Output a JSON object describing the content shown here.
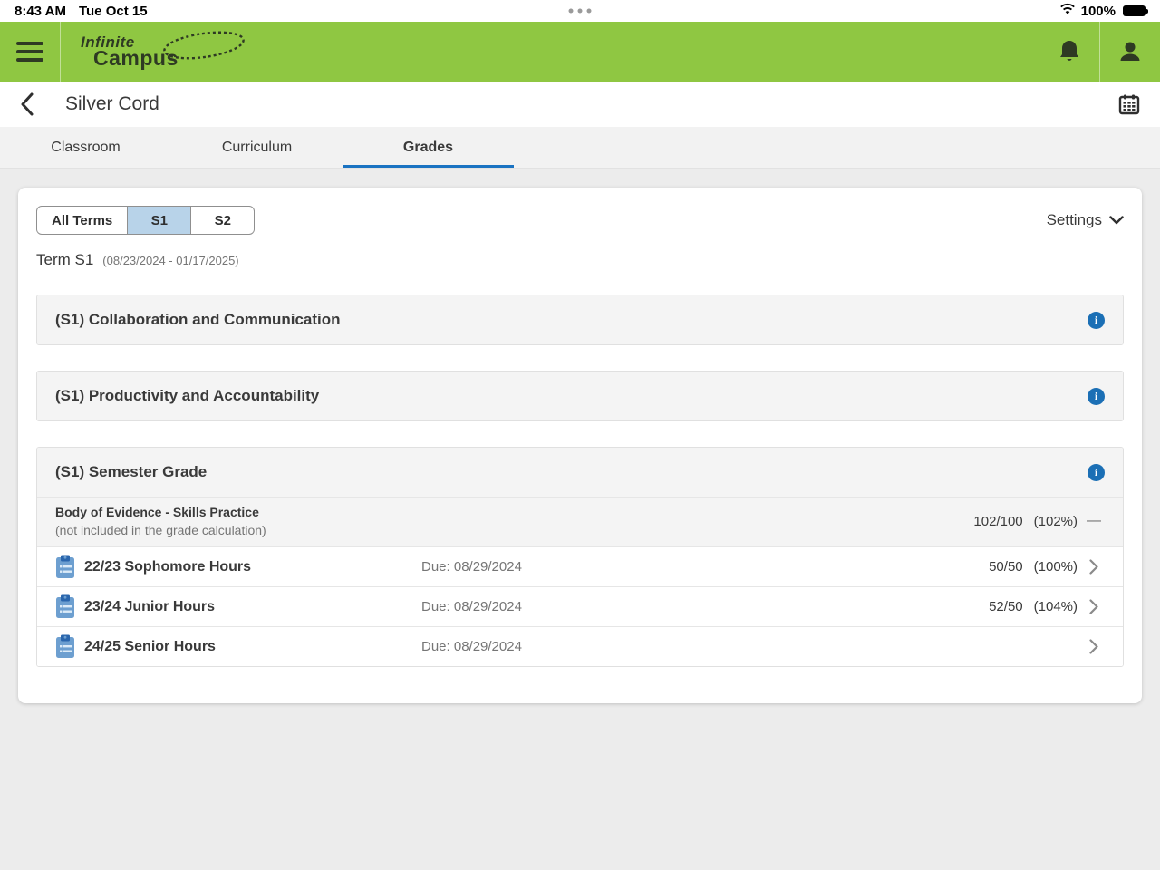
{
  "status_bar": {
    "time": "8:43 AM",
    "date": "Tue Oct 15",
    "battery_percent": "100%"
  },
  "appbar": {
    "logo_line1": "Infinite",
    "logo_line2": "Campus"
  },
  "page": {
    "title": "Silver Cord"
  },
  "tabs": [
    {
      "label": "Classroom"
    },
    {
      "label": "Curriculum"
    },
    {
      "label": "Grades"
    }
  ],
  "terms": {
    "chips": [
      {
        "label": "All Terms"
      },
      {
        "label": "S1"
      },
      {
        "label": "S2"
      }
    ],
    "settings_label": "Settings",
    "term_name": "Term S1",
    "term_range": "(08/23/2024 - 01/17/2025)"
  },
  "sections": [
    {
      "title": "(S1) Collaboration and Communication"
    },
    {
      "title": "(S1) Productivity and Accountability"
    },
    {
      "title": "(S1) Semester Grade",
      "category": {
        "name": "Body of Evidence - Skills Practice",
        "note": "(not included in the grade calculation)",
        "score": "102/100",
        "percent": "(102%)",
        "no_link_dash": "—"
      },
      "assignments": [
        {
          "title": "22/23 Sophomore Hours",
          "due": "Due: 08/29/2024",
          "score": "50/50",
          "percent": "(100%)"
        },
        {
          "title": "23/24 Junior Hours",
          "due": "Due: 08/29/2024",
          "score": "52/50",
          "percent": "(104%)"
        },
        {
          "title": "24/25 Senior Hours",
          "due": "Due: 08/29/2024",
          "score": "",
          "percent": ""
        }
      ]
    }
  ],
  "colors": {
    "brand_green": "#8fc742",
    "accent_blue": "#1a73c2",
    "info_blue": "#1b6fb5",
    "selected_chip": "#b8d3e9"
  }
}
